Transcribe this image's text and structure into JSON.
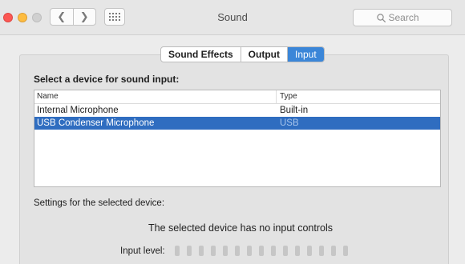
{
  "window": {
    "title": "Sound"
  },
  "toolbar": {
    "back_icon": "chevron-left-icon",
    "back_glyph": "❮",
    "forward_icon": "chevron-right-icon",
    "forward_glyph": "❯",
    "grid_icon": "show-all-grid-icon"
  },
  "search": {
    "placeholder": "Search",
    "value": ""
  },
  "tabs": [
    {
      "label": "Sound Effects",
      "active": false
    },
    {
      "label": "Output",
      "active": false
    },
    {
      "label": "Input",
      "active": true
    }
  ],
  "device_section": {
    "heading": "Select a device for sound input:",
    "columns": {
      "name": "Name",
      "type": "Type"
    },
    "rows": [
      {
        "name": "Internal Microphone",
        "type": "Built-in",
        "selected": false
      },
      {
        "name": "USB Condenser Microphone",
        "type": "USB",
        "selected": true
      }
    ]
  },
  "settings": {
    "label": "Settings for the selected device:",
    "no_controls_message": "The selected device has no input controls",
    "input_level_label": "Input level:",
    "input_level_value": 0,
    "input_level_segments": 15
  },
  "colors": {
    "accent": "#3b86d8",
    "selection": "#2f6dc0",
    "close": "#fc5753",
    "minimize": "#fdbc40",
    "zoom_inactive": "#d0d0d0"
  }
}
